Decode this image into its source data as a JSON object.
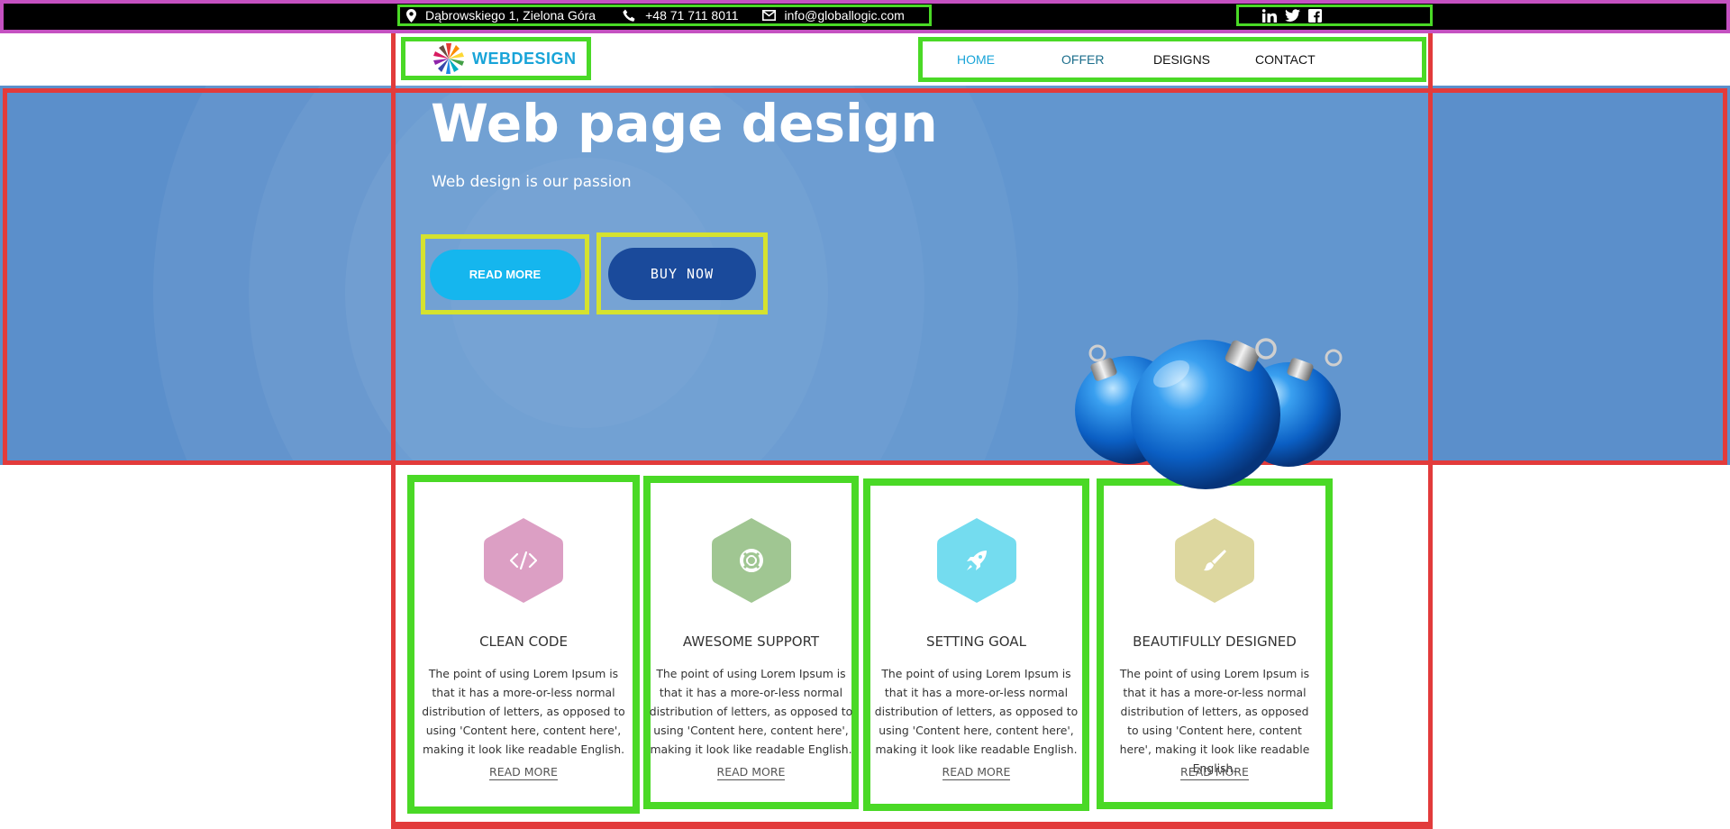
{
  "topbar": {
    "address": "Dąbrowskiego 1, Zielona Góra",
    "phone": "+48 71 711 8011",
    "email": "info@globallogic.com",
    "social_icons": [
      "linkedin-icon",
      "twitter-icon",
      "facebook-icon"
    ]
  },
  "header": {
    "logo_text": "WEBDESIGN",
    "nav": [
      {
        "label": "HOME",
        "active": true
      },
      {
        "label": "OFFER",
        "active": false
      },
      {
        "label": "DESIGNS",
        "active": false
      },
      {
        "label": "CONTACT",
        "active": false
      }
    ]
  },
  "hero": {
    "title": "Web page design",
    "subtitle": "Web design is our passion",
    "read_more_label": "READ MORE",
    "buy_now_label": "BUY NOW"
  },
  "features": [
    {
      "icon": "code-icon",
      "color": "#dc9fc4",
      "title": "CLEAN CODE",
      "text": "The point of using Lorem Ipsum is that it has a more-or-less normal distribution of letters, as opposed to using 'Content here, content here', making it look like readable English.",
      "link": "READ MORE"
    },
    {
      "icon": "support-icon",
      "color": "#a0c692",
      "title": "AWESOME SUPPORT",
      "text": "The point of using Lorem Ipsum is that it has a more-or-less normal distribution of letters, as opposed to using 'Content here, content here', making it look like readable English.",
      "link": "READ MORE"
    },
    {
      "icon": "rocket-icon",
      "color": "#74dcef",
      "title": "SETTING GOAL",
      "text": "The point of using Lorem Ipsum is that it has a more-or-less normal distribution of letters, as opposed to using 'Content here, content here', making it look like readable English.",
      "link": "READ MORE"
    },
    {
      "icon": "brush-icon",
      "color": "#ddd79f",
      "title": "BEAUTIFULLY DESIGNED",
      "text": "The point of using Lorem Ipsum is that it has a more-or-less normal distribution of letters, as opposed to using 'Content here, content here', making it look like readable English.",
      "link": "READ MORE"
    }
  ],
  "colors": {
    "nav_active": "#18a4d8",
    "nav_offer": "#1c6e8c",
    "nav_default": "#111111",
    "hero_bg": "#5b8fcb",
    "accent_button": "#15b6ee",
    "dark_button": "#1a4a9b"
  }
}
